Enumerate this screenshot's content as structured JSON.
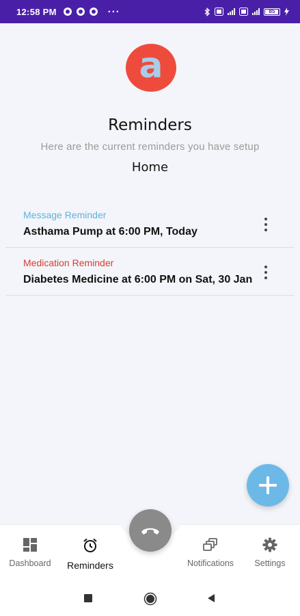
{
  "status_bar": {
    "time": "12:58 PM",
    "more": "···",
    "battery_label": "85",
    "battery_level": 0.85,
    "background_color": "#4a1fa8"
  },
  "header": {
    "logo_letter": "a",
    "logo_color": "#ef4b3c",
    "title": "Reminders",
    "subtitle": "Here are the current reminders you have setup",
    "location": "Home"
  },
  "reminders": [
    {
      "type": "Message Reminder",
      "type_color": "#5fb2da",
      "text": "Asthama Pump at 6:00 PM, Today",
      "menu_icon": "more-vertical-icon"
    },
    {
      "type": "Medication Reminder",
      "type_color": "#d93b2e",
      "text": "Diabetes Medicine at 6:00 PM on Sat, 30 Jan",
      "menu_icon": "more-vertical-icon"
    }
  ],
  "fab": {
    "icon": "plus-icon",
    "color": "#6cb9e8"
  },
  "call_button": {
    "icon": "phone-hangup-icon",
    "color": "#8a8a8a"
  },
  "bottom_nav": {
    "items": [
      {
        "label": "Dashboard",
        "icon": "dashboard-icon",
        "active": false
      },
      {
        "label": "Reminders",
        "icon": "alarm-clock-icon",
        "active": true
      },
      {
        "label": "Notifications",
        "icon": "notifications-icon",
        "active": false
      },
      {
        "label": "Settings",
        "icon": "gear-icon",
        "active": false
      }
    ]
  },
  "system_nav": {
    "items": [
      "recents-square-icon",
      "home-circle-icon",
      "back-triangle-icon"
    ]
  }
}
